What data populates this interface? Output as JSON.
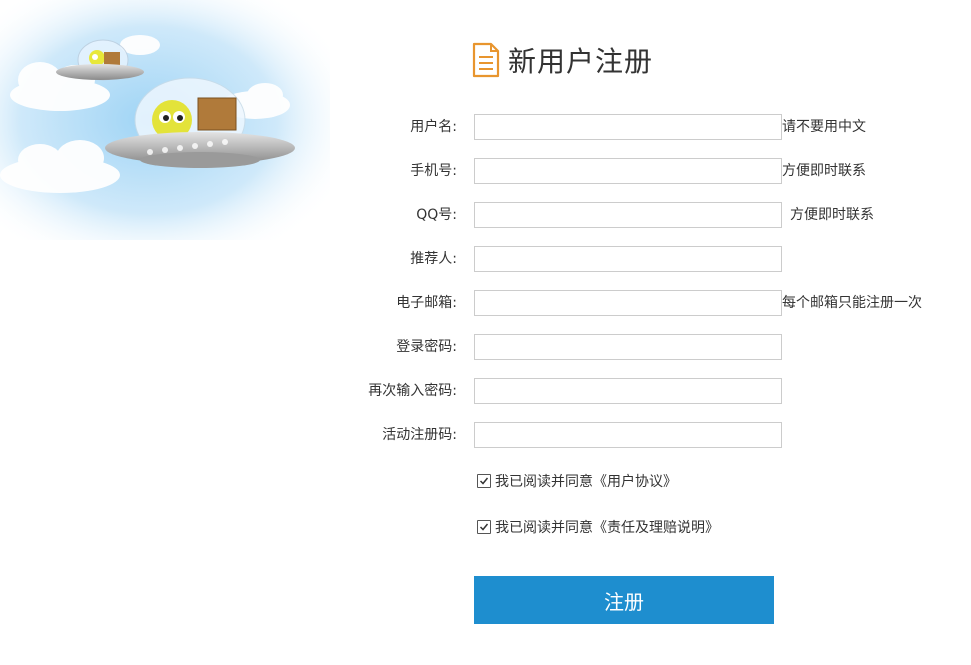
{
  "page": {
    "title": "新用户注册"
  },
  "form": {
    "fields": [
      {
        "label": "用户名:",
        "value": "",
        "hint": "请不要用中文"
      },
      {
        "label": "手机号:",
        "value": "",
        "hint": "方便即时联系"
      },
      {
        "label": "QQ号:",
        "value": "",
        "hint": "方便即时联系"
      },
      {
        "label": "推荐人:",
        "value": "",
        "hint": ""
      },
      {
        "label": "电子邮箱:",
        "value": "",
        "hint": "每个邮箱只能注册一次"
      },
      {
        "label": "登录密码:",
        "value": "",
        "hint": ""
      },
      {
        "label": "再次输入密码:",
        "value": "",
        "hint": ""
      },
      {
        "label": "活动注册码:",
        "value": "",
        "hint": ""
      }
    ],
    "agreements": [
      {
        "text": "我已阅读并同意《用户协议》",
        "checked": true
      },
      {
        "text": "我已阅读并同意《责任及理赔说明》",
        "checked": true
      }
    ],
    "submit_label": "注册"
  },
  "colors": {
    "accent": "#1e8ecf",
    "icon": "#e8952e"
  },
  "icons": {
    "title": "document-icon",
    "checkbox": "checkmark-icon"
  }
}
